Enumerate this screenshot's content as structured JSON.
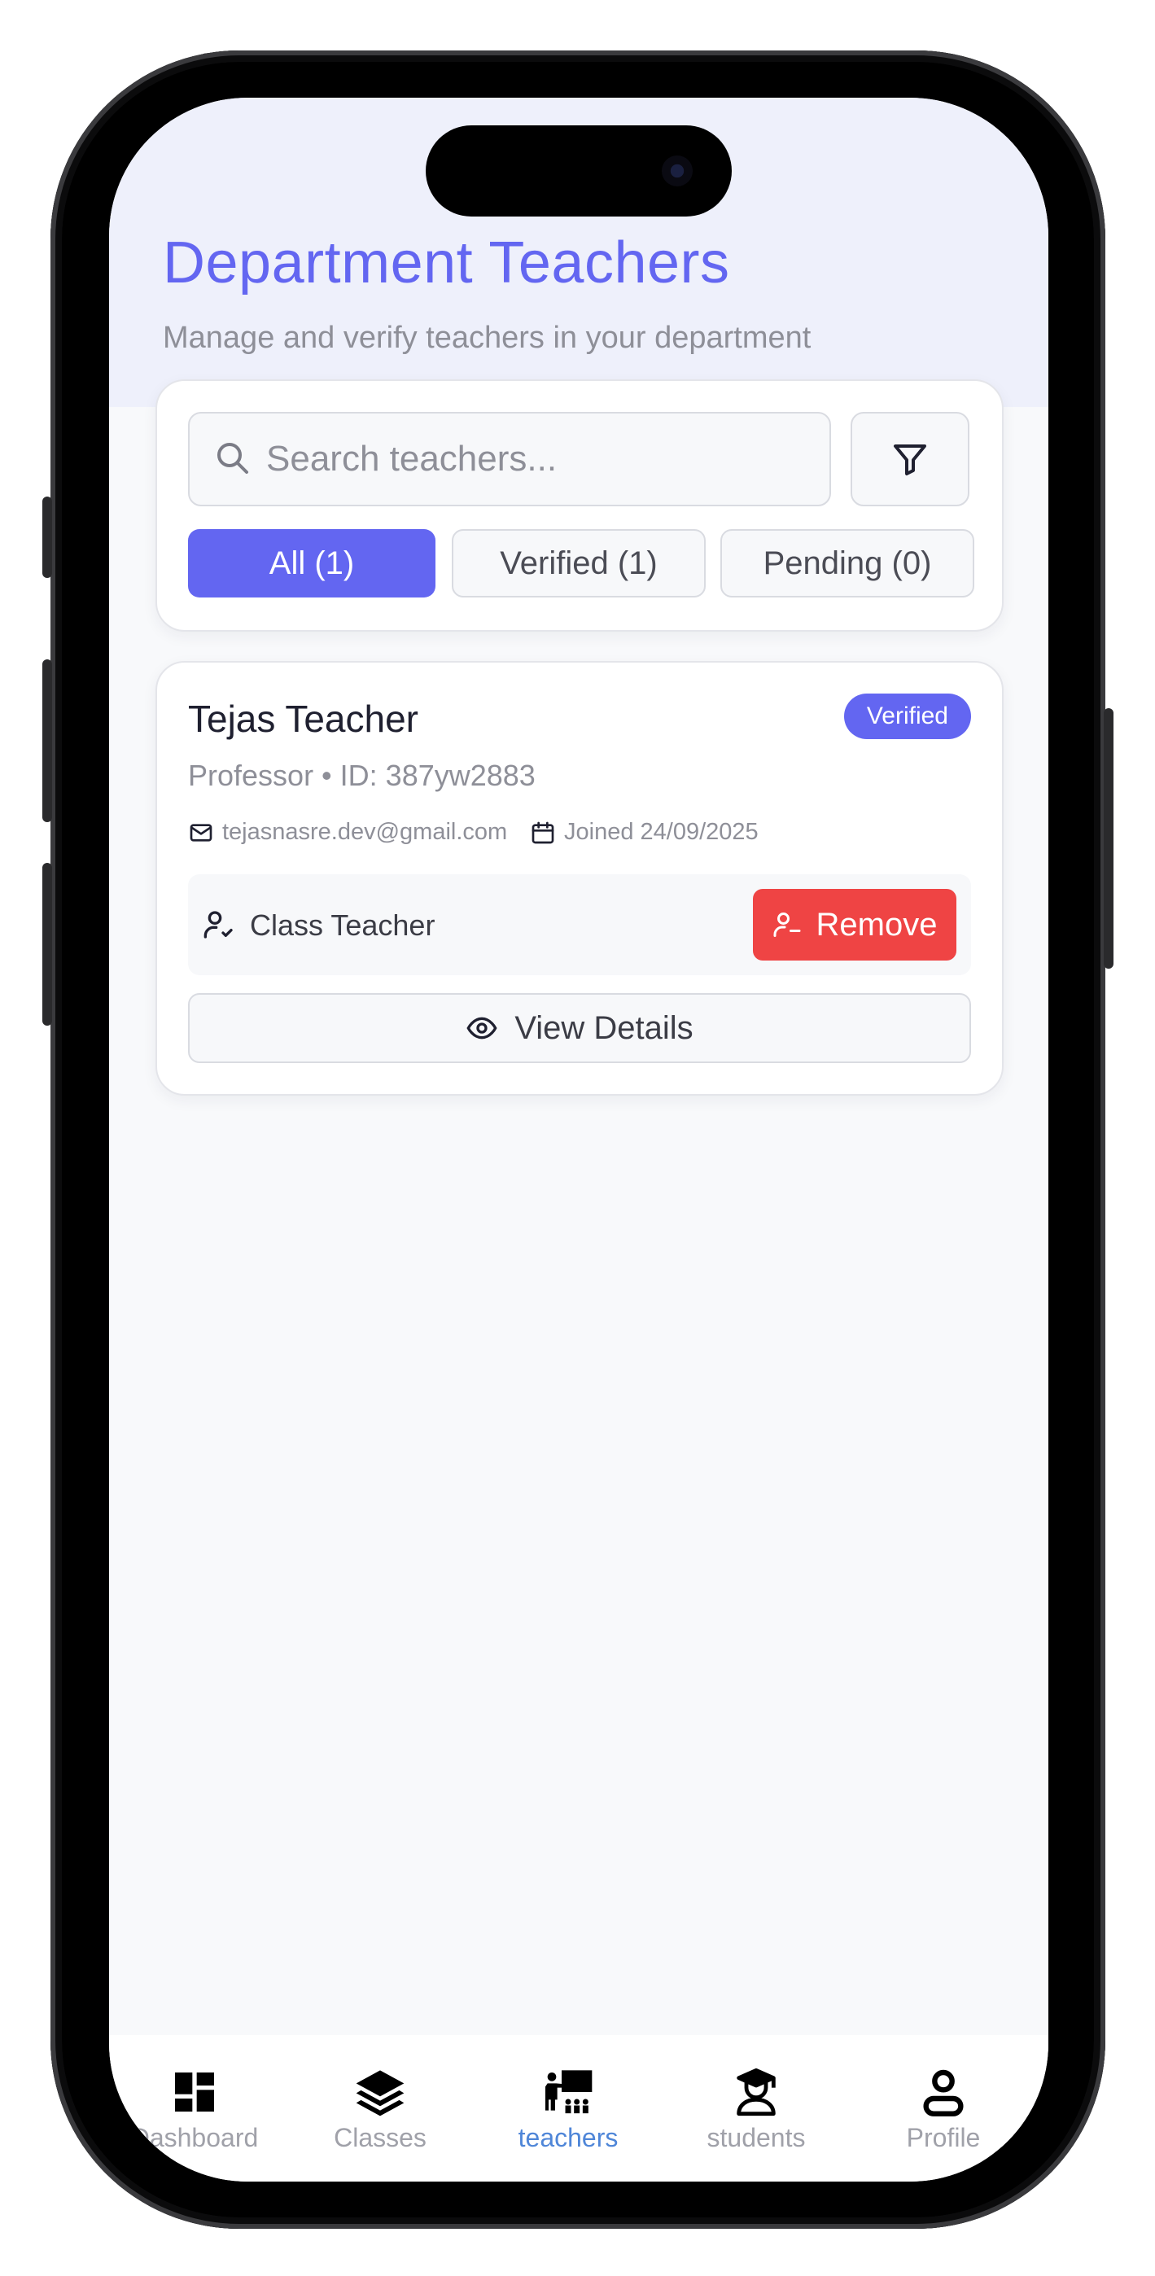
{
  "header": {
    "title": "Department Teachers",
    "subtitle": "Manage and verify teachers in your department"
  },
  "search": {
    "placeholder": "Search teachers...",
    "value": ""
  },
  "filter_tabs": [
    {
      "label": "All (1)",
      "active": true
    },
    {
      "label": "Verified (1)",
      "active": false
    },
    {
      "label": "Pending (0)",
      "active": false
    }
  ],
  "teacher": {
    "name": "Tejas Teacher",
    "status": "Verified",
    "meta": "Professor • ID: 387yw2883",
    "email": "tejasnasre.dev@gmail.com",
    "joined": "Joined 24/09/2025",
    "role": "Class Teacher",
    "remove_label": "Remove",
    "details_label": "View Details"
  },
  "nav": [
    {
      "label": "Dashboard",
      "icon": "dashboard-icon",
      "active": false
    },
    {
      "label": "Classes",
      "icon": "layers-icon",
      "active": false
    },
    {
      "label": "teachers",
      "icon": "teacher-board-icon",
      "active": true
    },
    {
      "label": "students",
      "icon": "graduation-cap-icon",
      "active": false
    },
    {
      "label": "Profile",
      "icon": "person-icon",
      "active": false
    }
  ],
  "colors": {
    "accent": "#6366f1",
    "danger": "#ef4444",
    "nav_active": "#4f86d8"
  }
}
